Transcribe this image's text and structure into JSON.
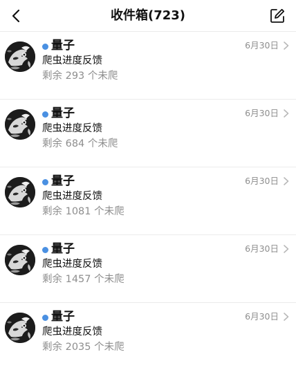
{
  "header": {
    "title": "收件箱(723)",
    "back_icon": "chevron-left-icon",
    "compose_icon": "compose-edit-icon"
  },
  "colors": {
    "unread_dot": "#4a90e2",
    "secondary_text": "#8e8e8e",
    "divider": "#ebebeb"
  },
  "messages": [
    {
      "sender": "量子",
      "subject": "爬虫进度反馈",
      "preview": "剩余 293 个未爬",
      "date": "6月30日",
      "unread": true
    },
    {
      "sender": "量子",
      "subject": "爬虫进度反馈",
      "preview": "剩余 684 个未爬",
      "date": "6月30日",
      "unread": true
    },
    {
      "sender": "量子",
      "subject": "爬虫进度反馈",
      "preview": "剩余 1081 个未爬",
      "date": "6月30日",
      "unread": true
    },
    {
      "sender": "量子",
      "subject": "爬虫进度反馈",
      "preview": "剩余 1457 个未爬",
      "date": "6月30日",
      "unread": true
    },
    {
      "sender": "量子",
      "subject": "爬虫进度反馈",
      "preview": "剩余 2035 个未爬",
      "date": "6月30日",
      "unread": true
    }
  ]
}
